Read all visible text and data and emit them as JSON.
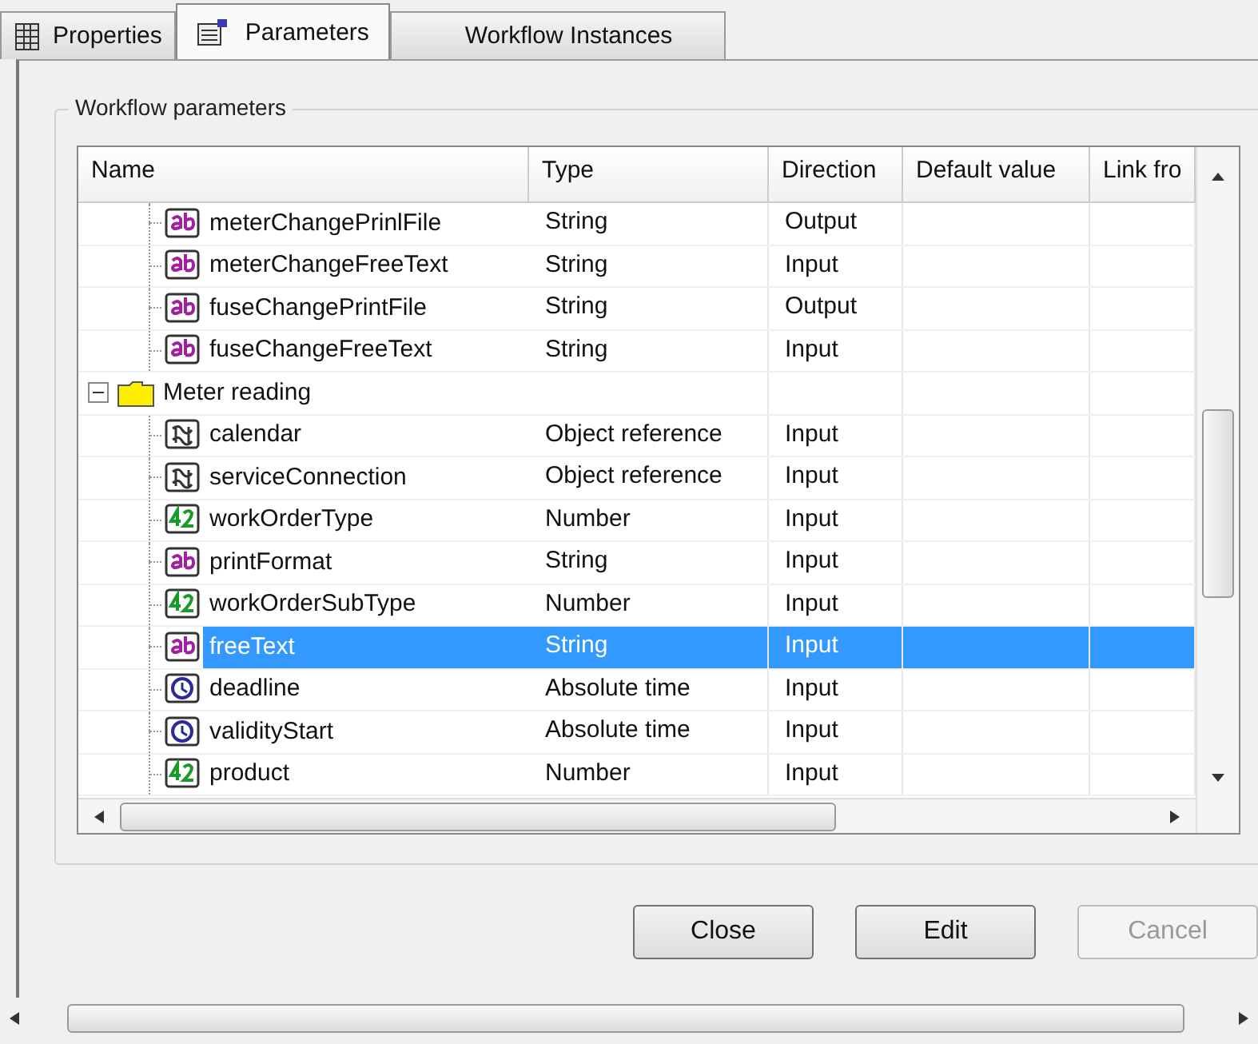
{
  "tabs": [
    {
      "label": "Properties",
      "selected": false
    },
    {
      "label": "Parameters",
      "selected": true
    },
    {
      "label": "Workflow Instances",
      "selected": false
    }
  ],
  "group": {
    "title": "Workflow parameters"
  },
  "grid": {
    "columns": [
      "Name",
      "Type",
      "Direction",
      "Default value",
      "Link fro"
    ],
    "rows": [
      {
        "name": "meterChangePrinlFile",
        "kind": "string",
        "type": "String",
        "direction": "Output",
        "selected": false
      },
      {
        "name": "meterChangeFreeText",
        "kind": "string",
        "type": "String",
        "direction": "Input",
        "selected": false
      },
      {
        "name": "fuseChangePrintFile",
        "kind": "string",
        "type": "String",
        "direction": "Output",
        "selected": false
      },
      {
        "name": "fuseChangeFreeText",
        "kind": "string",
        "type": "String",
        "direction": "Input",
        "selected": false
      },
      {
        "name": "Meter reading",
        "kind": "folder",
        "expanded": true,
        "selected": false,
        "children": [
          {
            "name": "calendar",
            "kind": "object",
            "type": "Object reference",
            "direction": "Input",
            "selected": false
          },
          {
            "name": "serviceConnection",
            "kind": "object",
            "type": "Object reference",
            "direction": "Input",
            "selected": false
          },
          {
            "name": "workOrderType",
            "kind": "number",
            "type": "Number",
            "direction": "Input",
            "selected": false
          },
          {
            "name": "printFormat",
            "kind": "string",
            "type": "String",
            "direction": "Input",
            "selected": false
          },
          {
            "name": "workOrderSubType",
            "kind": "number",
            "type": "Number",
            "direction": "Input",
            "selected": false
          },
          {
            "name": "freeText",
            "kind": "string",
            "type": "String",
            "direction": "Input",
            "selected": true
          },
          {
            "name": "deadline",
            "kind": "time",
            "type": "Absolute time",
            "direction": "Input",
            "selected": false
          },
          {
            "name": "validityStart",
            "kind": "time",
            "type": "Absolute time",
            "direction": "Input",
            "selected": false
          },
          {
            "name": "product",
            "kind": "number",
            "type": "Number",
            "direction": "Input",
            "selected": false
          }
        ]
      }
    ]
  },
  "buttons": [
    {
      "label": "Close",
      "disabled": false
    },
    {
      "label": "Edit",
      "disabled": false
    },
    {
      "label": "Cancel",
      "disabled": true
    }
  ]
}
